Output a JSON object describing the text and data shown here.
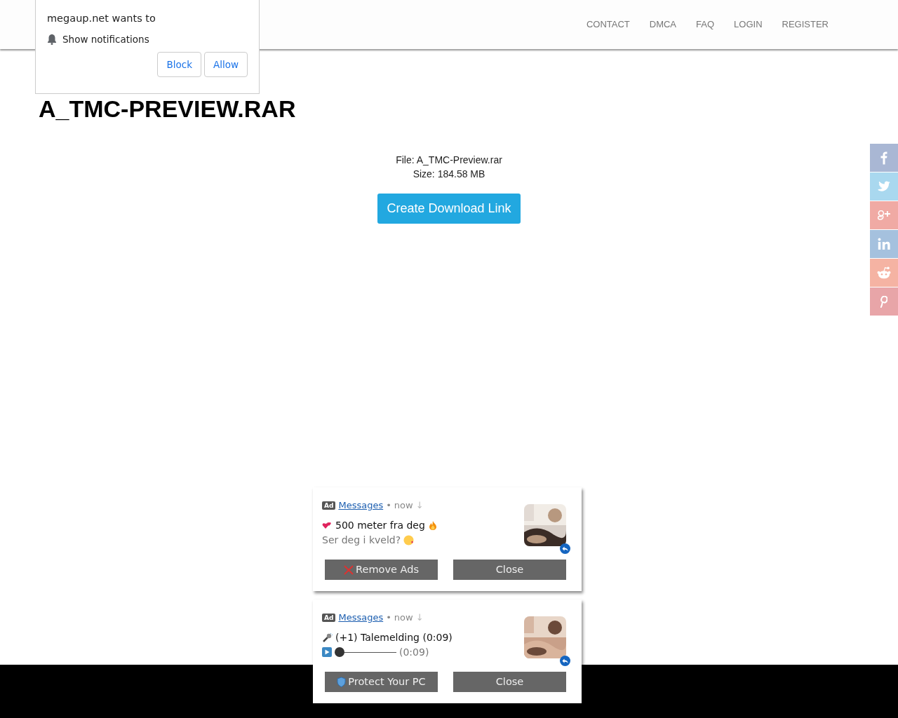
{
  "navbar": {
    "links": [
      {
        "label": "CONTACT"
      },
      {
        "label": "DMCA"
      },
      {
        "label": "FAQ"
      },
      {
        "label": "LOGIN"
      },
      {
        "label": "REGISTER"
      }
    ]
  },
  "page_title": "A_TMC-PREVIEW.RAR",
  "file_info": {
    "file": "File: A_TMC-Preview.rar",
    "size": "Size: 184.58 MB"
  },
  "download_button": "Create Download Link",
  "share_bar": [
    {
      "kind": "facebook",
      "color": "#a9b7d4"
    },
    {
      "kind": "twitter",
      "color": "#a9d8ef"
    },
    {
      "kind": "googleplus",
      "color": "#f0aaa4"
    },
    {
      "kind": "linkedin",
      "color": "#a5c1de"
    },
    {
      "kind": "reddit",
      "color": "#f5b3a3"
    },
    {
      "kind": "pinterest",
      "color": "#e8a5a8"
    }
  ],
  "permission_prompt": {
    "title": "megaup.net wants to",
    "permission": "Show notifications",
    "buttons": [
      "Block",
      "Allow"
    ]
  },
  "ads": [
    {
      "badge": "Ad",
      "source": "Messages",
      "separator": "•",
      "time": "now",
      "arrow": "↓",
      "kind": "text",
      "headline": "500 meter fra deg",
      "subline": "Ser deg i kveld?",
      "buttons": [
        {
          "label": "Remove Ads",
          "kind": "remove"
        },
        {
          "label": "Close",
          "kind": "plain"
        }
      ]
    },
    {
      "badge": "Ad",
      "source": "Messages",
      "separator": "•",
      "time": "now",
      "arrow": "↓",
      "kind": "audio",
      "headline": "(+1) Talemelding (0:09)",
      "level": 0,
      "duration": "(0:09)",
      "buttons": [
        {
          "label": "Protect Your PC",
          "kind": "protect"
        },
        {
          "label": "Close",
          "kind": "plain"
        }
      ]
    }
  ]
}
